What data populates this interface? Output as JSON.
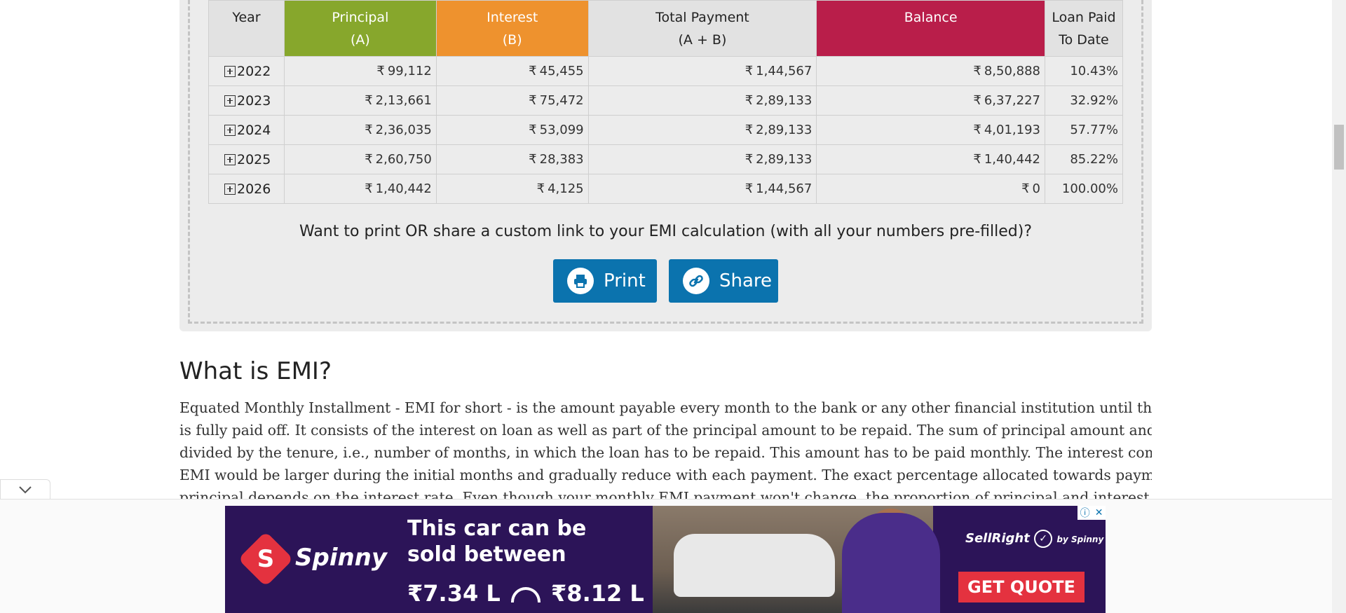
{
  "table": {
    "headers": {
      "year": "Year",
      "principal": "Principal",
      "principal_sub": "(A)",
      "interest": "Interest",
      "interest_sub": "(B)",
      "total": "Total Payment",
      "total_sub": "(A + B)",
      "balance": "Balance",
      "paid": "Loan Paid",
      "paid_sub": "To Date"
    },
    "currency": "₹",
    "rows": [
      {
        "year": "2022",
        "principal": "99,112",
        "interest": "45,455",
        "total": "1,44,567",
        "balance": "8,50,888",
        "paid": "10.43%"
      },
      {
        "year": "2023",
        "principal": "2,13,661",
        "interest": "75,472",
        "total": "2,89,133",
        "balance": "6,37,227",
        "paid": "32.92%"
      },
      {
        "year": "2024",
        "principal": "2,36,035",
        "interest": "53,099",
        "total": "2,89,133",
        "balance": "4,01,193",
        "paid": "57.77%"
      },
      {
        "year": "2025",
        "principal": "2,60,750",
        "interest": "28,383",
        "total": "2,89,133",
        "balance": "1,40,442",
        "paid": "85.22%"
      },
      {
        "year": "2026",
        "principal": "1,40,442",
        "interest": "4,125",
        "total": "1,44,567",
        "balance": "0",
        "paid": "100.00%"
      }
    ],
    "colors": {
      "principal": "#87a72c",
      "interest": "#ee922e",
      "balance": "#b91e4a"
    }
  },
  "share": {
    "question": "Want to print OR share a custom link to your EMI calculation (with all your numbers pre-filled)?",
    "print_label": "Print",
    "share_label": "Share",
    "button_color": "#0b73ae"
  },
  "article": {
    "title": "What is EMI?",
    "lines": [
      "Equated Monthly Installment - EMI for short - is the amount payable every month to the bank or any other financial institution until the loan amount",
      "is fully paid off. It consists of the interest on loan as well as part of the principal amount to be repaid. The sum of principal amount and interest is",
      "divided by the tenure, i.e., number of months, in which the loan has to be repaid. This amount has to be paid monthly. The interest component of the",
      "EMI would be larger during the initial months and gradually reduce with each payment. The exact percentage allocated towards payment of the",
      "principal depends on the interest rate. Even though your monthly EMI payment won't change, the proportion of principal and interest components"
    ]
  },
  "ad": {
    "brand": "Spinny",
    "logo_letter": "S",
    "headline_1": "This car can be",
    "headline_2": "sold between",
    "price_low": "₹7.34 L",
    "price_high": "₹8.12 L",
    "sellright": "SellRight",
    "sellright_by": "by Spinny",
    "cta": "GET QUOTE",
    "info_icon": "ⓘ",
    "close_icon": "✕"
  }
}
